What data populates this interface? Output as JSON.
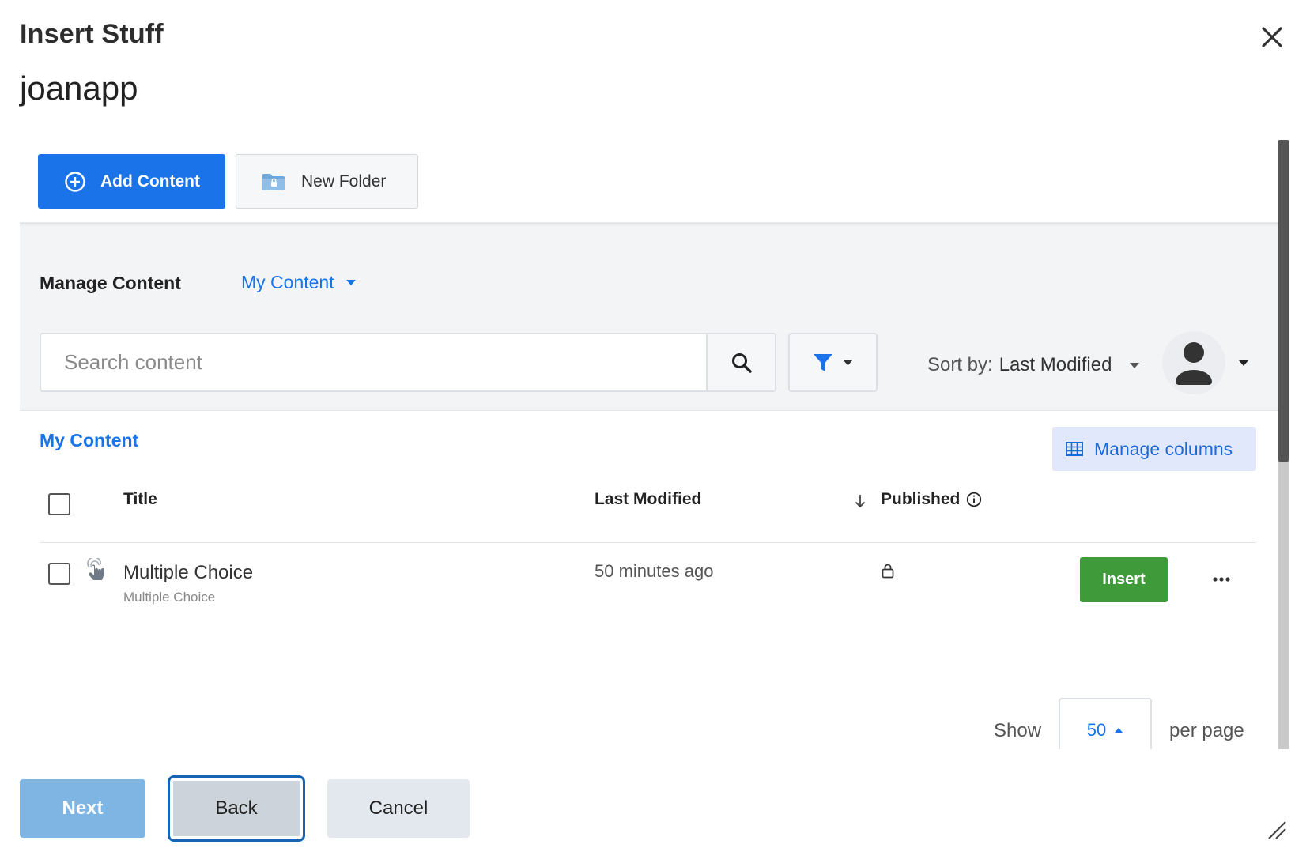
{
  "dialog": {
    "title": "Insert Stuff",
    "app_name": "joanapp"
  },
  "toolbar": {
    "add_content_label": "Add Content",
    "new_folder_label": "New Folder"
  },
  "manage": {
    "label": "Manage Content",
    "content_filter": "My Content",
    "search_placeholder": "Search content",
    "sort_prefix": "Sort by:",
    "sort_value": "Last Modified"
  },
  "list": {
    "heading": "My Content",
    "manage_columns_label": "Manage columns",
    "columns": {
      "title": "Title",
      "last_modified": "Last Modified",
      "published": "Published"
    },
    "rows": [
      {
        "title": "Multiple Choice",
        "type": "Multiple Choice",
        "last_modified": "50 minutes ago",
        "published_icon": "lock-icon",
        "action_label": "Insert"
      }
    ]
  },
  "pager": {
    "show_label": "Show",
    "per_page_value": "50",
    "per_page_label": "per page"
  },
  "footer": {
    "next_label": "Next",
    "back_label": "Back",
    "cancel_label": "Cancel"
  },
  "colors": {
    "primary": "#1a73e8",
    "insert_green": "#3f9a3a",
    "next_disabled": "#7fb5e3",
    "focus_outline": "#1565b4"
  }
}
